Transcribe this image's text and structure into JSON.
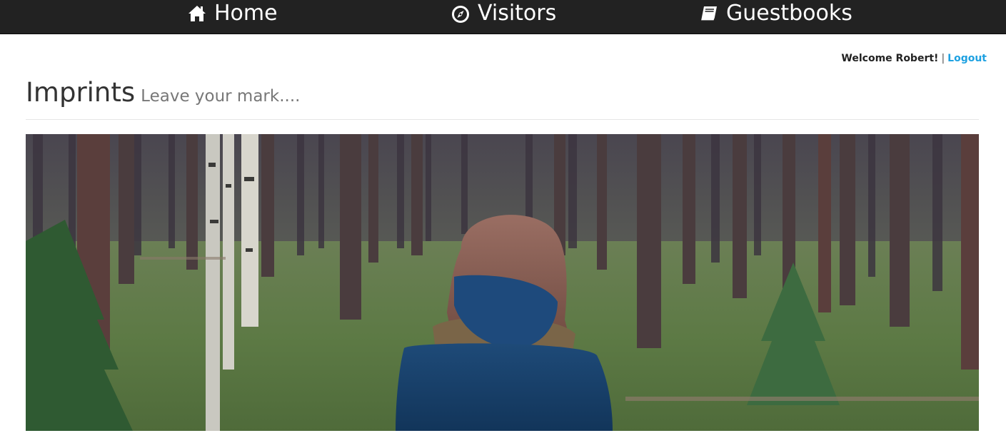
{
  "navbar": {
    "background": "#222222",
    "items": [
      {
        "label": "Home",
        "icon": "home-icon"
      },
      {
        "label": "Visitors",
        "icon": "compass-icon"
      },
      {
        "label": "Guestbooks",
        "icon": "book-icon"
      }
    ]
  },
  "user": {
    "welcome": "Welcome Robert!",
    "separator": "|",
    "logout_label": "Logout",
    "link_color": "#1ea1e1"
  },
  "header": {
    "title": "Imprints",
    "subtitle": "Leave your mark...."
  },
  "hero": {
    "description_icon": "forest-photo"
  }
}
